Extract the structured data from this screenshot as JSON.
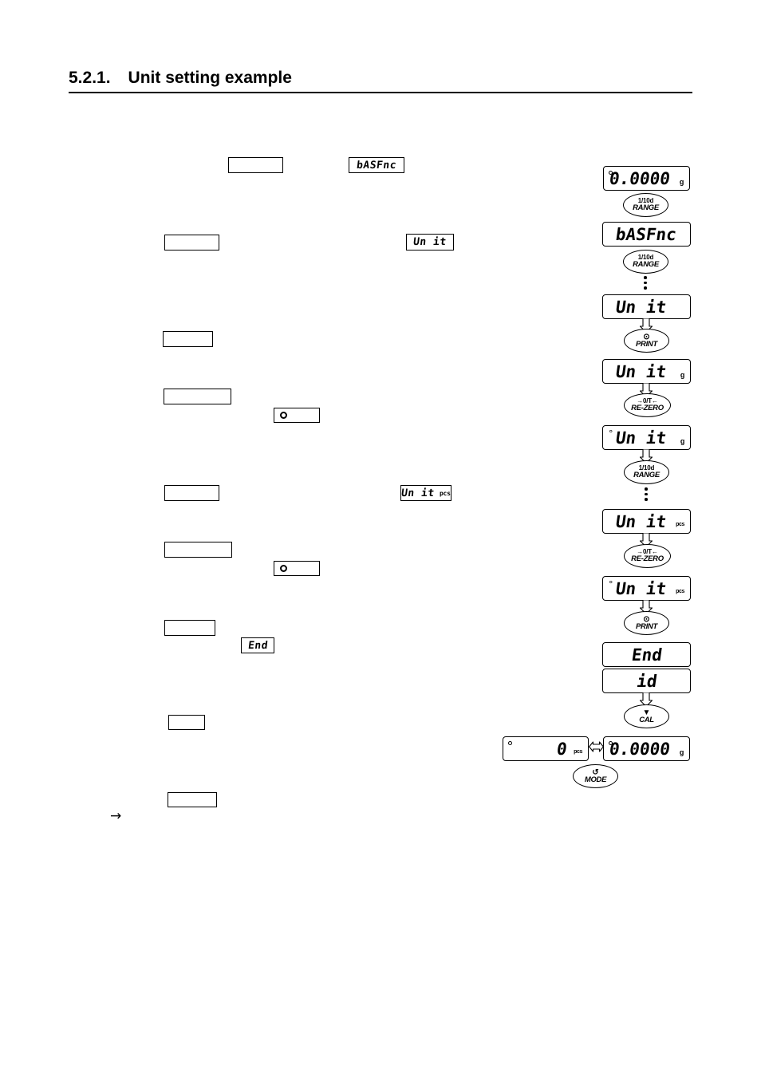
{
  "heading": {
    "number": "5.2.1.",
    "title": "Unit setting example"
  },
  "left_column": {
    "blank_boxes": [
      {
        "id": "step-1-caption"
      },
      {
        "id": "step-2-caption"
      },
      {
        "id": "step-3-caption"
      },
      {
        "id": "step-4-caption"
      },
      {
        "id": "step-5-caption"
      },
      {
        "id": "step-6-caption"
      },
      {
        "id": "step-7-caption"
      },
      {
        "id": "step-8-caption"
      },
      {
        "id": "step-9-caption"
      }
    ],
    "inline_displays": [
      {
        "id": "inline-basfnc",
        "value": "bASFnc",
        "unit": ""
      },
      {
        "id": "inline-unit",
        "value": "Un it",
        "unit": ""
      },
      {
        "id": "inline-unit-pcs",
        "value": "Un it",
        "unit": "pcs"
      },
      {
        "id": "inline-end",
        "value": "End",
        "unit": ""
      }
    ],
    "circle_chips": [
      {
        "id": "stability-mark-1"
      },
      {
        "id": "stability-mark-2"
      }
    ],
    "arrow_glyph": "→"
  },
  "flow": {
    "steps": [
      {
        "id": "display-weighing-zero",
        "type": "display",
        "value": "0.0000",
        "unit": "g",
        "stable_mark": true,
        "digit_mark": false
      },
      {
        "id": "key-range-1",
        "type": "key",
        "top": "1/10d",
        "bottom": "RANGE",
        "glyph": ""
      },
      {
        "id": "display-basfnc",
        "type": "display",
        "value": "bASFnc",
        "unit": "",
        "stable_mark": false,
        "digit_mark": false
      },
      {
        "id": "key-range-2",
        "type": "key",
        "top": "1/10d",
        "bottom": "RANGE",
        "glyph": ""
      },
      {
        "id": "dots-1",
        "type": "dots"
      },
      {
        "id": "display-unit",
        "type": "display",
        "value": "Un it",
        "unit": "",
        "stable_mark": false,
        "digit_mark": false
      },
      {
        "id": "key-print-1",
        "type": "key",
        "top": "",
        "bottom": "PRINT",
        "glyph": "⊙"
      },
      {
        "id": "display-unit-g",
        "type": "display",
        "value": "Un it",
        "unit": "g",
        "stable_mark": false,
        "digit_mark": false
      },
      {
        "id": "key-rezero-1",
        "type": "key",
        "top": "→0/T←",
        "bottom": "RE-ZERO",
        "glyph": ""
      },
      {
        "id": "display-unit-g-selected",
        "type": "display",
        "value": "Un it",
        "unit": "g",
        "stable_mark": false,
        "digit_mark": true
      },
      {
        "id": "key-range-3",
        "type": "key",
        "top": "1/10d",
        "bottom": "RANGE",
        "glyph": ""
      },
      {
        "id": "dots-2",
        "type": "dots"
      },
      {
        "id": "display-unit-pcs",
        "type": "display",
        "value": "Un it",
        "unit": "pcs",
        "stable_mark": false,
        "digit_mark": false
      },
      {
        "id": "key-rezero-2",
        "type": "key",
        "top": "→0/T←",
        "bottom": "RE-ZERO",
        "glyph": ""
      },
      {
        "id": "display-unit-pcs-selected",
        "type": "display",
        "value": "Un it",
        "unit": "pcs",
        "stable_mark": false,
        "digit_mark": true
      },
      {
        "id": "key-print-2",
        "type": "key",
        "top": "",
        "bottom": "PRINT",
        "glyph": "⊙"
      },
      {
        "id": "display-end",
        "type": "display",
        "value": "End",
        "unit": "",
        "stable_mark": false,
        "digit_mark": false
      },
      {
        "id": "display-id",
        "type": "display",
        "value": "id",
        "unit": "",
        "stable_mark": false,
        "digit_mark": false
      },
      {
        "id": "key-cal",
        "type": "key",
        "top": "",
        "bottom": "CAL",
        "glyph": "▼"
      },
      {
        "id": "display-count-pcs",
        "type": "display",
        "value": "0",
        "unit": "pcs",
        "stable_mark": true,
        "digit_mark": false
      },
      {
        "id": "display-weight-g",
        "type": "display",
        "value": "0.0000",
        "unit": "g",
        "stable_mark": true,
        "digit_mark": false
      },
      {
        "id": "key-mode",
        "type": "key",
        "top": "",
        "bottom": "MODE",
        "glyph": "↺"
      }
    ]
  }
}
